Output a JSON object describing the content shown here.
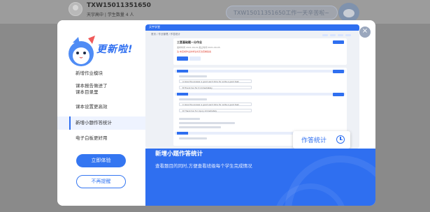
{
  "background": {
    "user_name": "TXW15011351650",
    "user_meta": "天宇高中 | 学生数量 4 人",
    "banner_text": "TXW15011351650工作一天辛苦啦~"
  },
  "modal": {
    "title": "更新啦!",
    "menu": [
      {
        "label": "新增作业模块"
      },
      {
        "label": "课本报告做进了"
      },
      {
        "label": "课本目录里"
      },
      {
        "label": "课本设置更高效"
      },
      {
        "label": "新增小题作答统计"
      },
      {
        "label": "电子白板更好用"
      }
    ],
    "active_index": 4,
    "try_button": "立即体验",
    "dismiss_button": "不再提醒",
    "close_icon": "×",
    "callout": "作答统计",
    "feature_title": "新增小题作答统计",
    "feature_desc": "查看题目的同时,方便查看班级每个学生完成情况"
  },
  "preview": {
    "logo": "天宇学堂",
    "breadcrumb": "首页 / 作业管理 / 作答统计",
    "card_title": "三套基础题一分作业",
    "card_meta": "发布时间 2021-09-01  截止时间 2021-09-05",
    "card_note": "注:未完成作业的学生将无法查看答案",
    "rows": [
      "A  Give the answer a good each time for write a good task",
      "B  Thank her for it immediately",
      "C  Give the answer a good each time for write a good task",
      "D  Thank her for injury immediately"
    ]
  },
  "colors": {
    "accent": "#2f6ff0",
    "overlay": "#8a8a8a"
  }
}
